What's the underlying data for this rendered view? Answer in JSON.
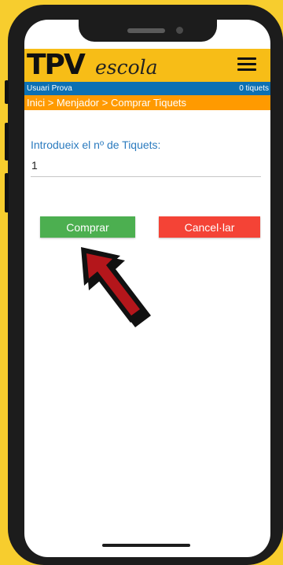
{
  "app": {
    "logo_main": "TPV",
    "logo_sub": "escola"
  },
  "user_bar": {
    "user": "Usuari Prova",
    "tickets": "0 tiquets"
  },
  "breadcrumb": "Inici > Menjador > Comprar Tiquets",
  "form": {
    "label": "Introdueix el nº de Tiquets:",
    "value": "1"
  },
  "buttons": {
    "buy": "Comprar",
    "cancel": "Cancel·lar"
  },
  "colors": {
    "background": "#f7cd2e",
    "header": "#f7bd17",
    "user_bar": "#0c70b3",
    "breadcrumb": "#ff9a00",
    "buy": "#4caf50",
    "cancel": "#f44336",
    "arrow": "#b4161b"
  },
  "icons": [
    "menu-icon",
    "pointer-arrow-icon"
  ]
}
